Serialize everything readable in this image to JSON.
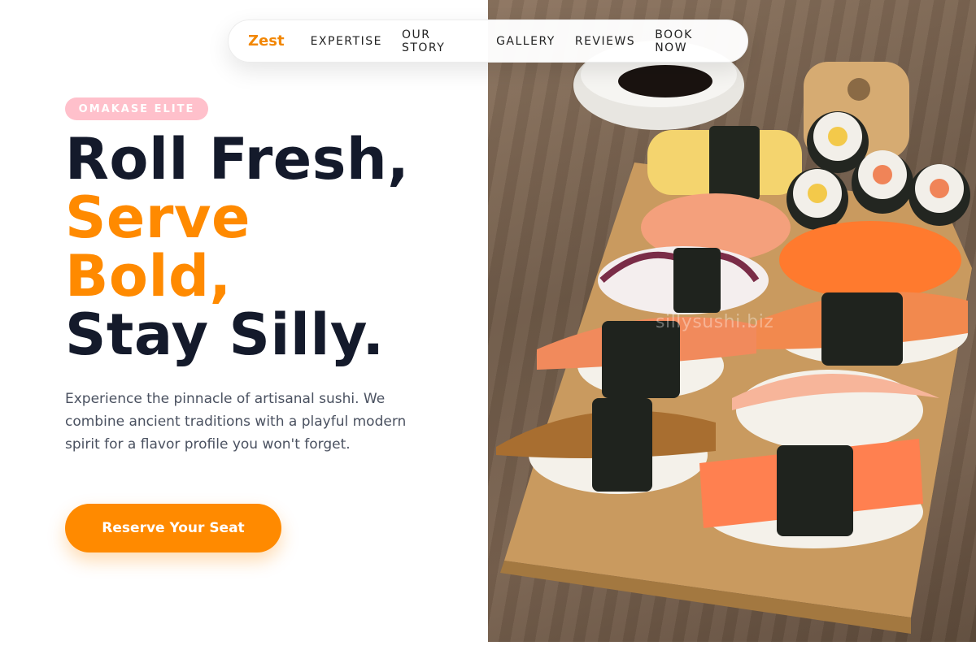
{
  "brand": {
    "logo": "Zest",
    "accent_color": "#ff8a00",
    "badge_color": "#ffc0cb"
  },
  "nav": {
    "links": [
      "EXPERTISE",
      "OUR STORY",
      "GALLERY",
      "REVIEWS",
      "BOOK NOW"
    ]
  },
  "hero": {
    "badge": "OMAKASE ELITE",
    "headline": {
      "line1": "Roll Fresh,",
      "line2": "Serve",
      "line3": "Bold,",
      "line4": "Stay Silly."
    },
    "description": "Experience the pinnacle of artisanal sushi. We combine ancient traditions with a playful modern spirit for a flavor profile you won't forget.",
    "cta_label": "Reserve Your Seat"
  },
  "image": {
    "subject": "sushi-platter-photo",
    "watermark": "sillysushi.biz"
  }
}
